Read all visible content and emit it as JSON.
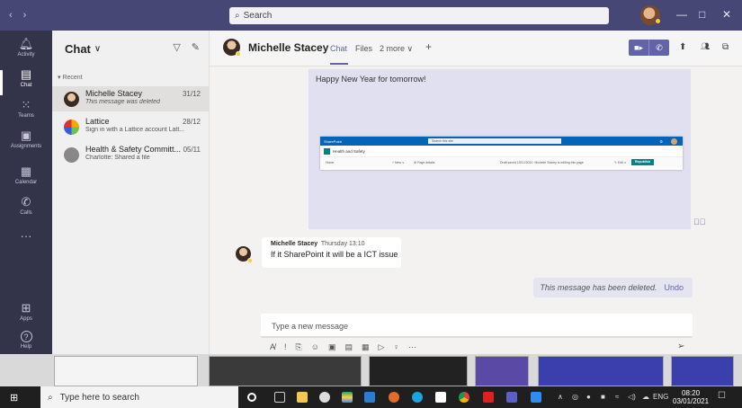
{
  "titlebar": {
    "back_icon": "‹",
    "forward_icon": "›",
    "search_placeholder": "Search",
    "minimize": "—",
    "maximize": "□",
    "close": "✕"
  },
  "rail": {
    "items": [
      {
        "label": "Activity",
        "icon": "bell-icon",
        "glyph": "🔔︎"
      },
      {
        "label": "Chat",
        "icon": "chat-icon",
        "glyph": "▤"
      },
      {
        "label": "Teams",
        "icon": "teams-icon",
        "glyph": "⁙"
      },
      {
        "label": "Assignments",
        "icon": "assignments-icon",
        "glyph": "▣"
      },
      {
        "label": "Calendar",
        "icon": "calendar-icon",
        "glyph": "▦"
      },
      {
        "label": "Calls",
        "icon": "phone-icon",
        "glyph": "✆"
      },
      {
        "label": "",
        "icon": "more-icon",
        "glyph": "···"
      },
      {
        "label": "Apps",
        "icon": "apps-icon",
        "glyph": "⊞"
      },
      {
        "label": "Help",
        "icon": "help-icon",
        "glyph": "?"
      }
    ]
  },
  "chatlist": {
    "title": "Chat",
    "recent_label": "Recent",
    "chats": [
      {
        "name": "Michelle Stacey",
        "preview": "This message was deleted",
        "date": "31/12",
        "selected": true
      },
      {
        "name": "Lattice",
        "preview": "Sign in with a Lattice account Latt...",
        "date": "28/12",
        "selected": false
      },
      {
        "name": "Health & Safety Committ...",
        "preview": "Charlotte: Shared a file",
        "date": "05/11",
        "selected": false
      }
    ]
  },
  "header": {
    "name": "Michelle Stacey",
    "tabs": [
      "Chat",
      "Files",
      "2 more"
    ],
    "add": "+"
  },
  "conversation": {
    "image_message_text": "Happy New Year for tomorrow!",
    "sharepoint": {
      "brand": "SharePoint",
      "search": "Search this site",
      "site_name": "Health and Safety",
      "home": "Home",
      "new": "+ New ∨",
      "page_details": "⚙ Page details",
      "draft": "Draft saved 10/12/2020",
      "editing": "Michelle Stacey is editing this page",
      "edit": "✎ Edit ∨",
      "republish": "Republish"
    },
    "message": {
      "author": "Michelle Stacey",
      "time": "Thursday 13:10",
      "text": "If it SharePoint it will be a ICT issue"
    },
    "deleted_text": "This message has been deleted.",
    "undo_label": "Undo",
    "compose_placeholder": "Type a new message"
  },
  "taskbar": {
    "search_placeholder": "Type here to search",
    "lang": "ENG",
    "time": "08:20",
    "date": "03/01/2021"
  },
  "colors": {
    "teams_purple": "#6264a7",
    "titlebar": "#464775",
    "rail": "#33344a"
  }
}
